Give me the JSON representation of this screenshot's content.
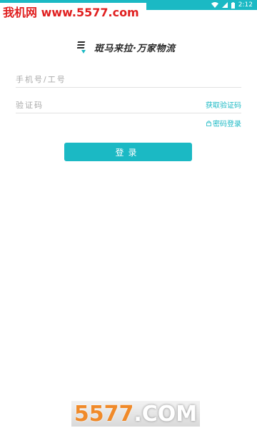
{
  "status_bar": {
    "time": "2:12",
    "icons": [
      "wifi-icon",
      "signal-icon",
      "battery-icon"
    ]
  },
  "watermark_top": "我机网 www.5577.com",
  "logo": {
    "text": "斑马来拉·万家物流",
    "icon": "zebra-logo-icon"
  },
  "form": {
    "phone_placeholder": "手机号/工号",
    "code_placeholder": "验证码",
    "get_code_label": "获取验证码",
    "password_login_label": "密码登录",
    "login_button_label": "登录"
  },
  "watermark_bottom": {
    "number": "5577",
    "suffix": ".COM"
  },
  "colors": {
    "accent": "#1bb9c4",
    "watermark_red": "#e02020",
    "watermark_orange": "#f08a2a"
  }
}
